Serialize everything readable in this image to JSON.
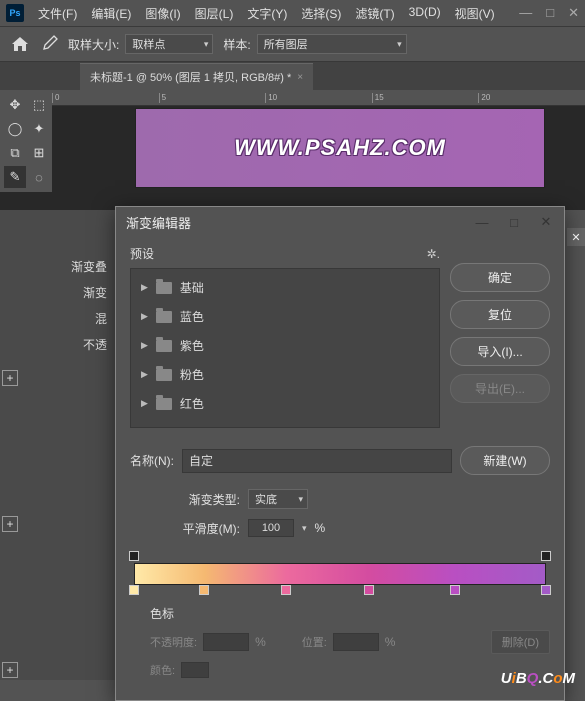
{
  "menubar": {
    "file": "文件(F)",
    "edit": "编辑(E)",
    "image": "图像(I)",
    "layer": "图层(L)",
    "type": "文字(Y)",
    "select": "选择(S)",
    "filter": "滤镜(T)",
    "threeD": "3D(D)",
    "view": "视图(V)"
  },
  "toolbar": {
    "sampleSizeLabel": "取样大小:",
    "sampleSizeValue": "取样点",
    "sampleLabel": "样本:",
    "sampleValue": "所有图层"
  },
  "docTab": "未标题-1 @ 50% (图层 1 拷贝, RGB/8#) *",
  "ruler": [
    "0",
    "5",
    "10",
    "15",
    "20"
  ],
  "canvasText": "WWW.PSAHZ.COM",
  "leftPanel": {
    "l1": "渐变叠",
    "l2": "渐变",
    "l3": "混",
    "l4": "不透"
  },
  "dialog": {
    "title": "渐变编辑器",
    "presetsLabel": "预设",
    "presets": [
      "基础",
      "蓝色",
      "紫色",
      "粉色",
      "红色"
    ],
    "buttons": {
      "ok": "确定",
      "reset": "复位",
      "import": "导入(I)...",
      "export": "导出(E)..."
    },
    "nameLabel": "名称(N):",
    "nameValue": "自定",
    "newBtn": "新建(W)",
    "gradTypeLabel": "渐变类型:",
    "gradTypeValue": "实底",
    "smoothLabel": "平滑度(M):",
    "smoothValue": "100",
    "percent": "%",
    "stopsTitle": "色标",
    "opacityLabel": "不透明度:",
    "positionLabel": "位置:",
    "colorLabel": "颜色:",
    "deleteBtn": "删除(D)",
    "colorStops": [
      {
        "pos": 0,
        "color": "#ffe9a8"
      },
      {
        "pos": 17,
        "color": "#f5b971"
      },
      {
        "pos": 37,
        "color": "#ec6a9e"
      },
      {
        "pos": 57,
        "color": "#d44ca0"
      },
      {
        "pos": 78,
        "color": "#b94fc2"
      },
      {
        "pos": 100,
        "color": "#a35bc7"
      }
    ]
  },
  "watermark": "UiBQ.CoM"
}
